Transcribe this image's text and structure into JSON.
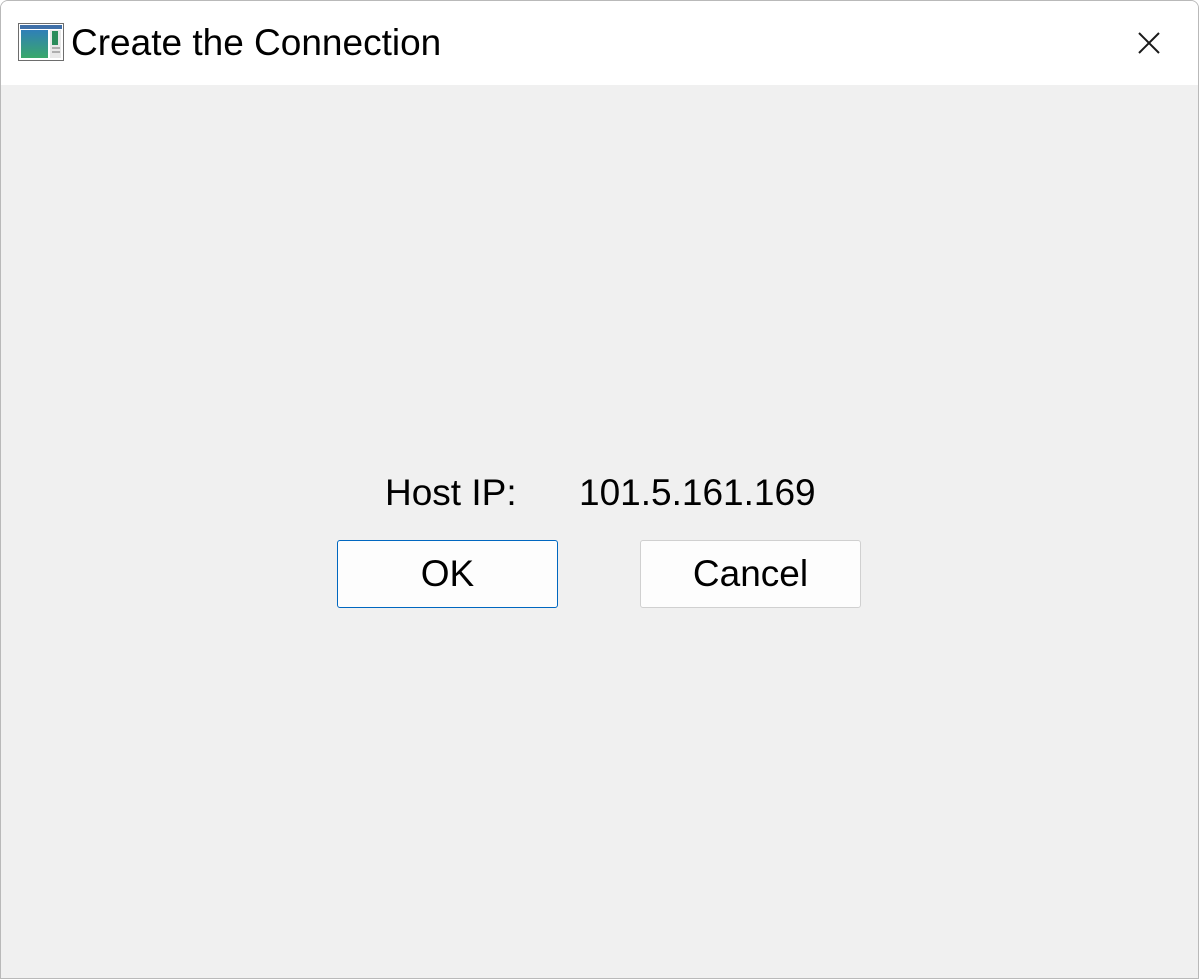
{
  "window": {
    "title": "Create the Connection"
  },
  "icons": {
    "app": "app-window-icon",
    "close": "close-icon"
  },
  "form": {
    "host_label": "Host IP:",
    "host_value": "101.5.161.169"
  },
  "buttons": {
    "ok_label": "OK",
    "cancel_label": "Cancel"
  },
  "colors": {
    "titlebar_bg": "#ffffff",
    "client_bg": "#f0f0f0",
    "default_button_border": "#0067c0",
    "button_border": "#d0d0d0",
    "button_bg": "#fdfdfd"
  }
}
